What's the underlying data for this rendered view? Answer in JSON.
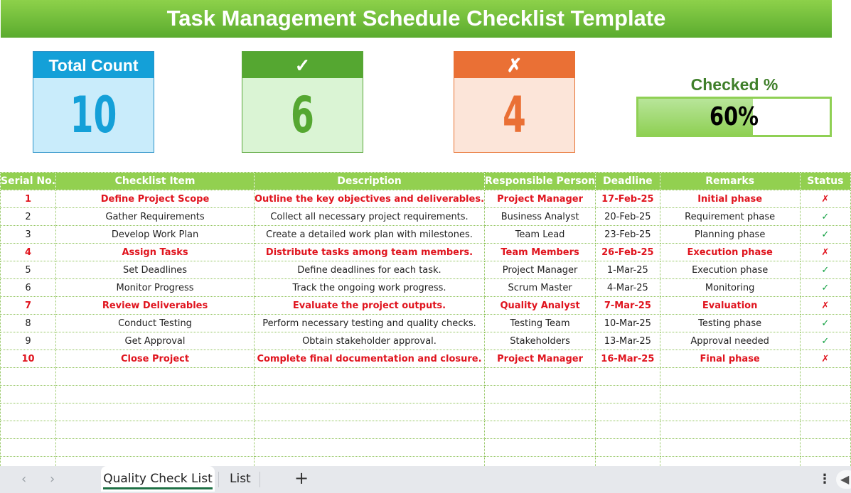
{
  "title": "Task Management Schedule Checklist Template",
  "cards": {
    "total": {
      "label": "Total Count",
      "value": "10"
    },
    "checked": {
      "label": "✓",
      "value": "6"
    },
    "unchecked": {
      "label": "✗",
      "value": "4"
    }
  },
  "progress": {
    "label": "Checked %",
    "value_text": "60%",
    "fraction": 0.6
  },
  "table": {
    "headers": [
      "Serial No.",
      "Checklist Item",
      "Description",
      "Responsible Person",
      "Deadline",
      "Remarks",
      "Status"
    ],
    "rows": [
      {
        "serial": "1",
        "item": "Define Project Scope",
        "description": "Outline the key objectives and deliverables.",
        "person": "Project Manager",
        "deadline": "17-Feb-25",
        "remarks": "Initial phase",
        "status": "✗",
        "checked": false
      },
      {
        "serial": "2",
        "item": "Gather Requirements",
        "description": "Collect all necessary project requirements.",
        "person": "Business Analyst",
        "deadline": "20-Feb-25",
        "remarks": "Requirement phase",
        "status": "✓",
        "checked": true
      },
      {
        "serial": "3",
        "item": "Develop Work Plan",
        "description": "Create a detailed work plan with milestones.",
        "person": "Team Lead",
        "deadline": "23-Feb-25",
        "remarks": "Planning phase",
        "status": "✓",
        "checked": true
      },
      {
        "serial": "4",
        "item": "Assign Tasks",
        "description": "Distribute tasks among team members.",
        "person": "Team Members",
        "deadline": "26-Feb-25",
        "remarks": "Execution phase",
        "status": "✗",
        "checked": false
      },
      {
        "serial": "5",
        "item": "Set Deadlines",
        "description": "Define deadlines for each task.",
        "person": "Project Manager",
        "deadline": "1-Mar-25",
        "remarks": "Execution phase",
        "status": "✓",
        "checked": true
      },
      {
        "serial": "6",
        "item": "Monitor Progress",
        "description": "Track the ongoing work progress.",
        "person": "Scrum Master",
        "deadline": "4-Mar-25",
        "remarks": "Monitoring",
        "status": "✓",
        "checked": true
      },
      {
        "serial": "7",
        "item": "Review Deliverables",
        "description": "Evaluate the project outputs.",
        "person": "Quality Analyst",
        "deadline": "7-Mar-25",
        "remarks": "Evaluation",
        "status": "✗",
        "checked": false
      },
      {
        "serial": "8",
        "item": "Conduct Testing",
        "description": "Perform necessary testing and quality checks.",
        "person": "Testing Team",
        "deadline": "10-Mar-25",
        "remarks": "Testing phase",
        "status": "✓",
        "checked": true
      },
      {
        "serial": "9",
        "item": "Get Approval",
        "description": "Obtain stakeholder approval.",
        "person": "Stakeholders",
        "deadline": "13-Mar-25",
        "remarks": "Approval needed",
        "status": "✓",
        "checked": true
      },
      {
        "serial": "10",
        "item": "Close Project",
        "description": "Complete final documentation and closure.",
        "person": "Project Manager",
        "deadline": "16-Mar-25",
        "remarks": "Final phase",
        "status": "✗",
        "checked": false
      }
    ],
    "empty_rows": 6
  },
  "sheet_tabs": {
    "tabs": [
      "Quality Check List",
      "List"
    ],
    "active": "Quality Check List",
    "prev_icon": "‹",
    "next_icon": "›",
    "add_icon": "+",
    "more_icon": "⋮",
    "scroll_icon": "◀"
  },
  "colors": {
    "header_green": "#92d050",
    "checked_green": "#10a040",
    "unchecked_red": "#e0141e",
    "total_blue": "#14a0d8",
    "x_orange": "#ea7035"
  }
}
